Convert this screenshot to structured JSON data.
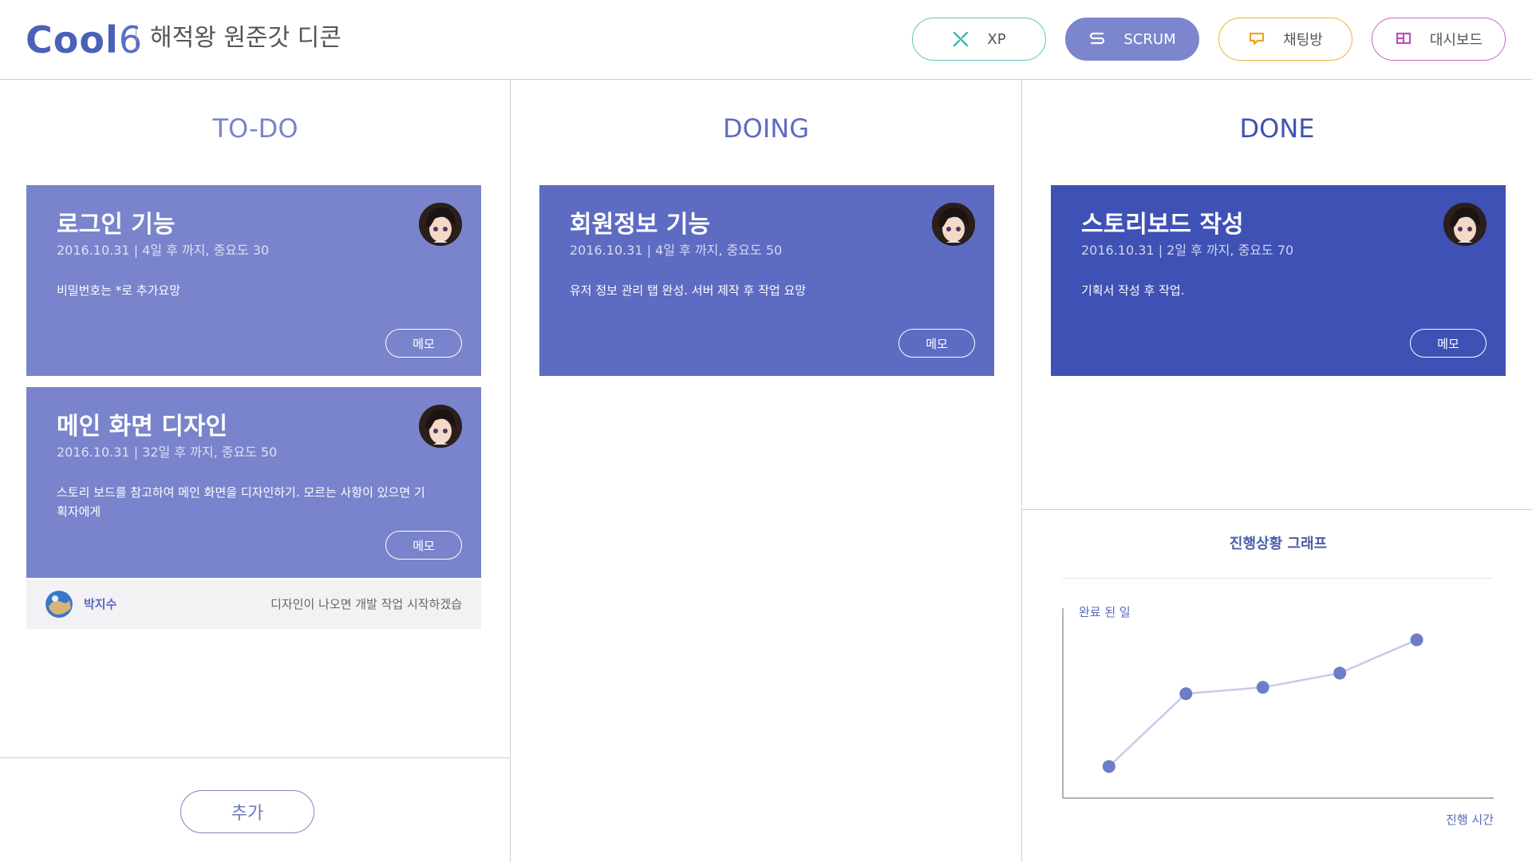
{
  "header": {
    "logo_main": "Cool",
    "logo_num": "6",
    "project_title": "해적왕 원준갓 디콘",
    "buttons": {
      "xp": "XP",
      "scrum": "SCRUM",
      "chat": "채팅방",
      "dashboard": "대시보드"
    }
  },
  "columns": {
    "todo": "TO-DO",
    "doing": "DOING",
    "done": "DONE"
  },
  "cards": {
    "login": {
      "title": "로그인 기능",
      "meta": "2016.10.31 | 4일 후 까지, 중요도 30",
      "body": "비밀번호는 *로 추가요망",
      "memo": "메모"
    },
    "main_design": {
      "title": "메인 화면 디자인",
      "meta": "2016.10.31 | 32일 후 까지, 중요도 50",
      "body": "스토리 보드를 참고하여 메인 화면을 디자인하기. 모르는 사항이 있으면 기획자에게",
      "memo": "메모"
    },
    "member": {
      "title": "회원정보 기능",
      "meta": "2016.10.31 | 4일 후 까지, 중요도 50",
      "body": "유저 정보 관리 탭 완성. 서버 제작 후 작업 요망",
      "memo": "메모"
    },
    "storyboard": {
      "title": "스토리보드 작성",
      "meta": "2016.10.31 | 2일 후 까지, 중요도 70",
      "body": "기획서 작성 후 작업.",
      "memo": "메모"
    }
  },
  "comment": {
    "name": "박지수",
    "text": "디자인이 나오면 개발 작업 시작하겠습"
  },
  "add_label": "추가",
  "graph": {
    "title": "진행상황 그래프",
    "ylabel": "완료 된 일",
    "xlabel": "진행 시간"
  },
  "chart_data": {
    "type": "line",
    "title": "진행상황 그래프",
    "xlabel": "진행 시간",
    "ylabel": "완료 된 일",
    "x": [
      1,
      2,
      3,
      4,
      5
    ],
    "values": [
      1.0,
      3.3,
      3.5,
      3.95,
      5.0
    ],
    "ylim": [
      0,
      6
    ],
    "grid": false,
    "colors": {
      "line": "#c5cbea",
      "point": "#6f7cc6"
    }
  },
  "colors": {
    "card_todo": "#7984cc",
    "card_doing": "#5d6bc2",
    "card_done": "#3f51b5",
    "title_todo": "#7984cc",
    "title_doing": "#5d6bc2",
    "title_done": "#3f51b5"
  }
}
